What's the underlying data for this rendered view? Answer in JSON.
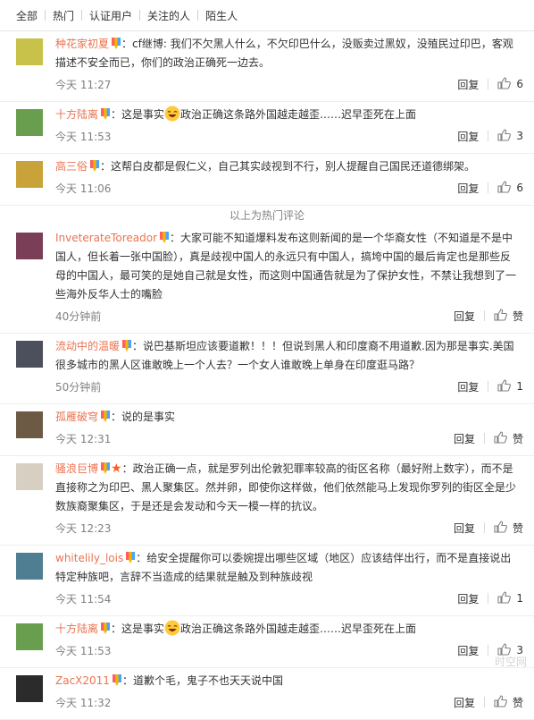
{
  "tabs": [
    "全部",
    "热门",
    "认证用户",
    "关注的人",
    "陌生人"
  ],
  "hot_divider": "以上为热门评论",
  "reply_label": "回复",
  "like_label": "赞",
  "comments": [
    {
      "user": "种花家初夏",
      "text": "：cf继博: 我们不欠黑人什么，不欠印巴什么，没贩卖过黑奴，没殖民过印巴，客观描述不安全而已，你们的政治正确死一边去。",
      "time": "今天 11:27",
      "likes": "6",
      "avatar_color": "#c8c24a"
    },
    {
      "user": "十方陆离",
      "text_before": "：这是事实",
      "text_after": "政治正确这条路外国越走越歪……迟早歪死在上面",
      "time": "今天 11:53",
      "likes": "3",
      "avatar_color": "#6a9e4f"
    },
    {
      "user": "高三俗",
      "text": "：这帮白皮都是假仁义，自己其实歧视到不行，别人提醒自己国民还道德绑架。",
      "time": "今天 11:06",
      "likes": "6",
      "avatar_color": "#c9a23a"
    },
    {
      "user": "InveterateToreador",
      "text": "：大家可能不知道爆料发布这则新闻的是一个华裔女性（不知道是不是中国人，但长着一张中国脸），真是歧视中国人的永远只有中国人，搞垮中国的最后肯定也是那些反母的中国人，最可笑的是她自己就是女性，而这则中国通告就是为了保护女性，不禁让我想到了一些海外反华人士的嘴脸",
      "time": "40分钟前",
      "likes": "",
      "avatar_color": "#7a3e56"
    },
    {
      "user": "流动中的温暖",
      "text": "：说巴基斯坦应该要道歉！！！但说到黑人和印度裔不用道歉.因为那是事实.美国很多城市的黑人区谁敢晚上一个人去？一个女人谁敢晚上单身在印度逛马路？",
      "time": "50分钟前",
      "likes": "1",
      "avatar_color": "#4c4f5c"
    },
    {
      "user": "孤雁破穹",
      "text": "：说的是事实",
      "time": "今天 12:31",
      "likes": "",
      "avatar_color": "#6d5a44"
    },
    {
      "user": "骚浪巨博",
      "text": "：政治正确一点，就是罗列出伦敦犯罪率较高的街区名称（最好附上数字），而不是直接称之为印巴、黑人聚集区。然并卵，即使你这样做，他们依然能马上发现你罗列的街区全是少数族裔聚集区，于是还是会发动和今天一模一样的抗议。",
      "time": "今天 12:23",
      "likes": "",
      "avatar_color": "#d8cfc3"
    },
    {
      "user": "whitelily_lois",
      "text": "：给安全提醒你可以委婉提出哪些区域（地区）应该结伴出行，而不是直接说出特定种族吧，言辞不当造成的结果就是触及到种族歧视",
      "time": "今天 11:54",
      "likes": "1",
      "avatar_color": "#4f7e92"
    },
    {
      "user": "十方陆离",
      "text_before": "：这是事实",
      "text_after": "政治正确这条路外国越走越歪……迟早歪死在上面",
      "time": "今天 11:53",
      "likes": "3",
      "avatar_color": "#6a9e4f"
    },
    {
      "user": "ZacX2011",
      "text": "：道歉个毛，鬼子不也天天说中国",
      "time": "今天 11:32",
      "likes": "",
      "avatar_color": "#2b2b2b"
    }
  ],
  "watermark": "时空网"
}
